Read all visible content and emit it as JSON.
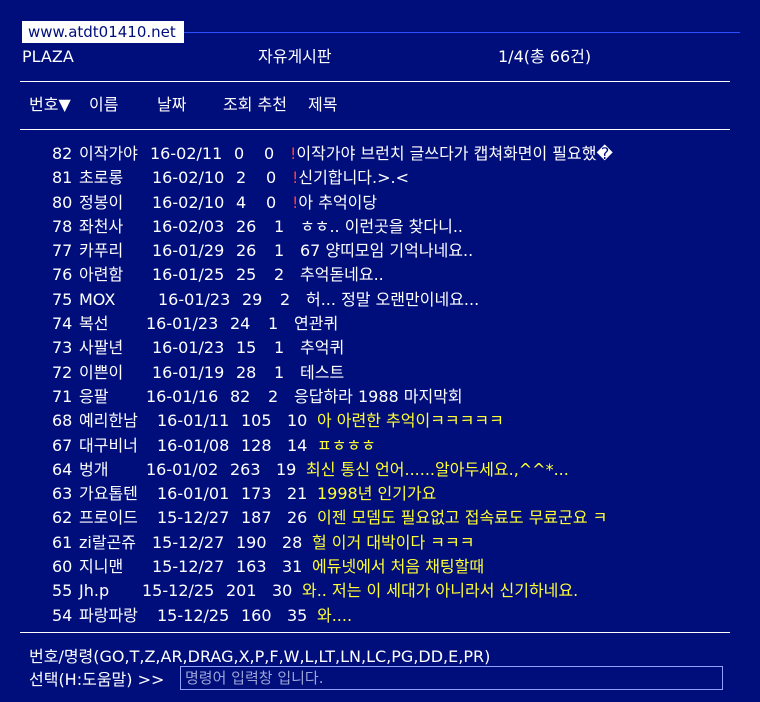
{
  "url": "www.atdt01410.net",
  "header": {
    "left": "PLAZA",
    "center": "자유게시판",
    "right": "1/4(총 66건)"
  },
  "columns": {
    "sort": "번호▼",
    "name": "이름",
    "date": "날짜",
    "views_rec": "조회 추천",
    "title": "제목"
  },
  "posts": [
    {
      "no": "82",
      "name": "이작가야",
      "date": "16-02/11",
      "views": "0",
      "rec": "0",
      "mark": "!",
      "title": "이작가야 브런치 글쓰다가 캡쳐화면이 필요했�",
      "hot": false
    },
    {
      "no": "81",
      "name": "초로롱",
      "date": "16-02/10",
      "views": "2",
      "rec": "0",
      "mark": "!",
      "title": "신기합니다.>.<",
      "hot": false
    },
    {
      "no": "80",
      "name": "정봉이",
      "date": "16-02/10",
      "views": "4",
      "rec": "0",
      "mark": "!",
      "title": "아 추억이당",
      "hot": false
    },
    {
      "no": "78",
      "name": "좌천사",
      "date": "16-02/03",
      "views": "26",
      "rec": "1",
      "mark": "",
      "title": "ㅎㅎ.. 이런곳을 찾다니..",
      "hot": false
    },
    {
      "no": "77",
      "name": "카푸리",
      "date": "16-01/29",
      "views": "26",
      "rec": "1",
      "mark": "",
      "title": "67 양띠모임 기억나네요..",
      "hot": false
    },
    {
      "no": "76",
      "name": "아련함",
      "date": "16-01/25",
      "views": "25",
      "rec": "2",
      "mark": "",
      "title": "추억돋네요..",
      "hot": false
    },
    {
      "no": "75",
      "name": "MOX",
      "date": "16-01/23",
      "views": "29",
      "rec": "2",
      "mark": "",
      "title": "허... 정말 오랜만이네요...",
      "hot": false
    },
    {
      "no": "74",
      "name": "복선",
      "date": "16-01/23",
      "views": "24",
      "rec": "1",
      "mark": "",
      "title": "연관퀴",
      "hot": false
    },
    {
      "no": "73",
      "name": "사팔년",
      "date": "16-01/23",
      "views": "15",
      "rec": "1",
      "mark": "",
      "title": "추억퀴",
      "hot": false
    },
    {
      "no": "72",
      "name": "이쁜이",
      "date": "16-01/19",
      "views": "28",
      "rec": "1",
      "mark": "",
      "title": "테스트",
      "hot": false
    },
    {
      "no": "71",
      "name": "응팔",
      "date": "16-01/16",
      "views": "82",
      "rec": "2",
      "mark": "",
      "title": "응답하라 1988 마지막회",
      "hot": false
    },
    {
      "no": "68",
      "name": "예리한남",
      "date": "16-01/11",
      "views": "105",
      "rec": "10",
      "mark": "",
      "title": "아 아련한 추억이ㅋㅋㅋㅋㅋ",
      "hot": true
    },
    {
      "no": "67",
      "name": "대구비너",
      "date": "16-01/08",
      "views": "128",
      "rec": "14",
      "mark": "",
      "title": "ㅍㅎㅎㅎ",
      "hot": true
    },
    {
      "no": "64",
      "name": "벙개",
      "date": "16-01/02",
      "views": "263",
      "rec": "19",
      "mark": "",
      "title": "최신 통신 언어......알아두세요.,^^*...",
      "hot": true
    },
    {
      "no": "63",
      "name": "가요톱텐",
      "date": "16-01/01",
      "views": "173",
      "rec": "21",
      "mark": "",
      "title": "1998년 인기가요",
      "hot": true
    },
    {
      "no": "62",
      "name": "프로이드",
      "date": "15-12/27",
      "views": "187",
      "rec": "26",
      "mark": "",
      "title": "이젠 모뎀도 필요없고 접속료도 무료군요 ㅋ",
      "hot": true
    },
    {
      "no": "61",
      "name": "zi랄곤쥬",
      "date": "15-12/27",
      "views": "190",
      "rec": "28",
      "mark": "",
      "title": "헐 이거 대박이다 ㅋㅋㅋ",
      "hot": true
    },
    {
      "no": "60",
      "name": "지니맨",
      "date": "15-12/27",
      "views": "163",
      "rec": "31",
      "mark": "",
      "title": "에듀넷에서 처음 채팅할때",
      "hot": true
    },
    {
      "no": "55",
      "name": "Jh.p",
      "date": "15-12/25",
      "views": "201",
      "rec": "30",
      "mark": "",
      "title": "와.. 저는 이 세대가 아니라서 신기하네요.",
      "hot": true
    },
    {
      "no": "54",
      "name": "파랑파랑",
      "date": "15-12/25",
      "views": "160",
      "rec": "35",
      "mark": "",
      "title": "와....",
      "hot": true
    }
  ],
  "footer": {
    "commands": "번호/명령(GO,T,Z,AR,DRAG,X,P,F,W,L,LT,LN,LC,PG,DD,E,PR)",
    "prompt": "선택(H:도움말) >>",
    "input_placeholder": "명령어 입력창 입니다.",
    "input_value": ""
  },
  "colors": {
    "background": "#000e7b",
    "text": "#ffffff",
    "highlight": "#ffff33",
    "new_mark": "#ff3a3a"
  }
}
